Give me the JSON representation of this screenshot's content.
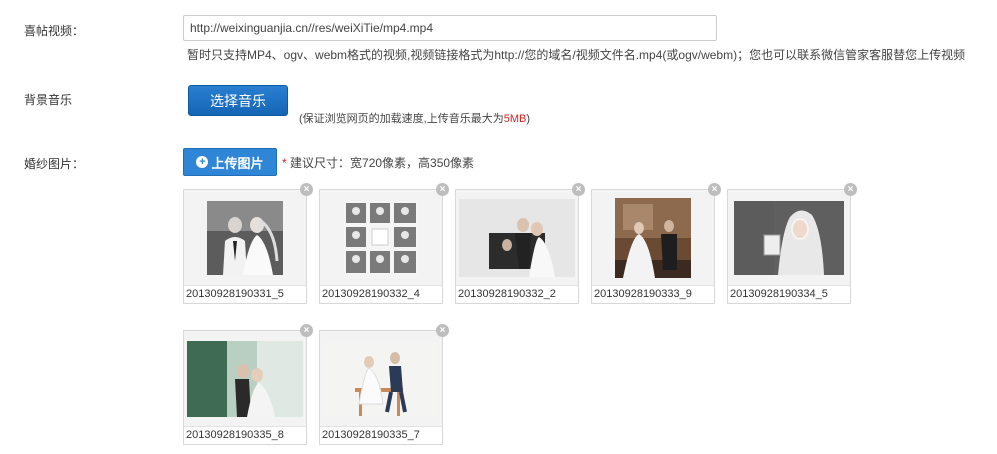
{
  "video": {
    "label": "喜帖视频：",
    "url_value": "http://weixinguanjia.cn//res/weiXiTie/mp4.mp4",
    "hint": "暂时只支持MP4、ogv、webm格式的视频,视频链接格式为http://您的域名/视频文件名.mp4(或ogv/webm)；您也可以联系微信管家客服替您上传视频"
  },
  "music": {
    "label": "背景音乐",
    "button_label": "选择音乐",
    "hint_prefix": "(保证浏览网页的加载速度,上传音乐最大为",
    "hint_size": "5MB",
    "hint_suffix": ")"
  },
  "photos": {
    "label": "婚纱图片：",
    "upload_label": "上传图片",
    "required_mark": "*",
    "size_hint": "建议尺寸：宽720像素，高350像素",
    "items": [
      {
        "caption": "20130928190331_5"
      },
      {
        "caption": "20130928190332_4"
      },
      {
        "caption": "20130928190332_2"
      },
      {
        "caption": "20130928190333_9"
      },
      {
        "caption": "20130928190334_5"
      },
      {
        "caption": "20130928190335_8"
      },
      {
        "caption": "20130928190335_7"
      }
    ],
    "close_glyph": "×"
  },
  "colors": {
    "accent": "#2f86d6",
    "required": "#e02020"
  }
}
